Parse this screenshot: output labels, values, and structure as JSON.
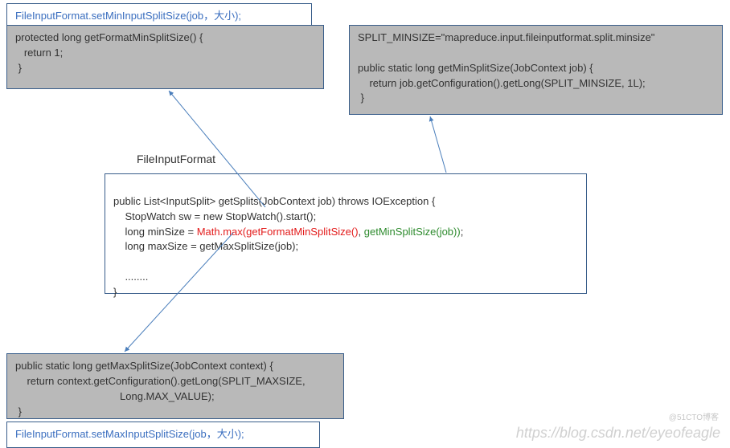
{
  "top_left_caption": "FileInputFormat.setMinInputSplitSize(job，大小);",
  "box_format_min": "protected long getFormatMinSplitSize() {\n   return 1;\n }",
  "box_split_minsize": "SPLIT_MINSIZE=\"mapreduce.input.fileinputformat.split.minsize\"\n\npublic static long getMinSplitSize(JobContext job) {\n    return job.getConfiguration().getLong(SPLIT_MINSIZE, 1L);\n }",
  "class_label": "FileInputFormat",
  "center_box": {
    "line1": "public List<InputSplit> getSplits(JobContext job) throws IOException {",
    "line2": "    StopWatch sw = new StopWatch().start();",
    "line3_prefix": "    long minSize = ",
    "line3_red": "Math.max(getFormatMinSplitSize()",
    "line3_mid": ", ",
    "line3_green": "getMinSplitSize(job))",
    "line3_suffix": ";",
    "line4": "    long maxSize = getMaxSplitSize(job);",
    "dots": "    ........",
    "close": "}"
  },
  "box_max_split": "public static long getMaxSplitSize(JobContext context) {\n    return context.getConfiguration().getLong(SPLIT_MAXSIZE,\n                                    Long.MAX_VALUE);\n }",
  "bottom_caption": "FileInputFormat.setMaxInputSplitSize(job，大小);",
  "watermark_main": "https://blog.csdn.net/eyeofeagle",
  "watermark_small": "@51CTO博客"
}
